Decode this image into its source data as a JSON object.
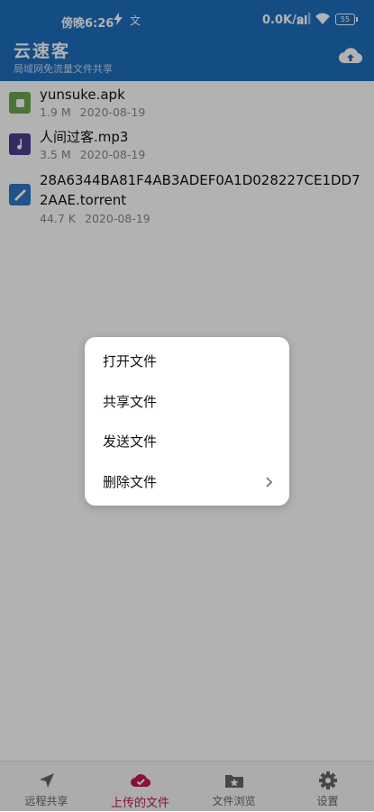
{
  "status_bar": {
    "time": "傍晚6:26",
    "input_indicator": "文",
    "network_speed": "0.0K/s",
    "battery": "55"
  },
  "app_bar": {
    "title": "云速客",
    "subtitle": "局域网免流量文件共享"
  },
  "files": [
    {
      "name": "yunsuke.apk",
      "size": "1.9 M",
      "date": "2020-08-19",
      "icon": "apk-icon",
      "color": "#6aa84f"
    },
    {
      "name": "人间过客.mp3",
      "size": "3.5 M",
      "date": "2020-08-19",
      "icon": "music-icon",
      "color": "#4c3f8f"
    },
    {
      "name": "28A6344BA81F4AB3ADEF0A1D028227CE1DD72AAE.torrent",
      "size": "44.7 K",
      "date": "2020-08-19",
      "icon": "torrent-icon",
      "color": "#2f78c4"
    }
  ],
  "context_menu": {
    "items": [
      "打开文件",
      "共享文件",
      "发送文件",
      "删除文件"
    ]
  },
  "bottom_nav": {
    "tabs": [
      {
        "label": "远程共享",
        "icon": "navigation-arrow-icon"
      },
      {
        "label": "上传的文件",
        "icon": "cloud-check-icon"
      },
      {
        "label": "文件浏览",
        "icon": "folder-star-icon"
      },
      {
        "label": "设置",
        "icon": "gear-icon"
      }
    ],
    "active_index": 1,
    "active_color": "#c2185b"
  }
}
